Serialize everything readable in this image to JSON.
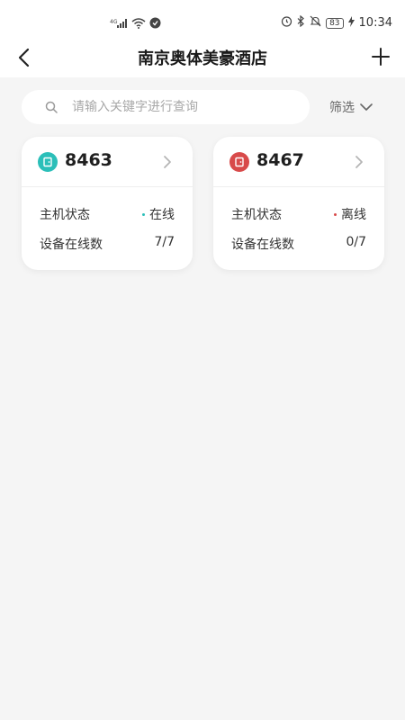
{
  "status_bar": {
    "signal_label": "4G",
    "battery": "83",
    "time": "10:34"
  },
  "header": {
    "title": "南京奥体美豪酒店"
  },
  "search": {
    "placeholder": "请输入关键字进行查询",
    "value": ""
  },
  "filter": {
    "label": "筛选"
  },
  "colors": {
    "online": "#2bbfb9",
    "offline": "#d84a4a"
  },
  "rooms": [
    {
      "number": "8463",
      "host_status_label": "主机状态",
      "host_status_value": "在线",
      "devices_label": "设备在线数",
      "devices_value": "7/7",
      "badge_icon": "door-icon",
      "status_color": "#2bbfb9"
    },
    {
      "number": "8467",
      "host_status_label": "主机状态",
      "host_status_value": "离线",
      "devices_label": "设备在线数",
      "devices_value": "0/7",
      "badge_icon": "door-icon",
      "status_color": "#d84a4a"
    }
  ]
}
